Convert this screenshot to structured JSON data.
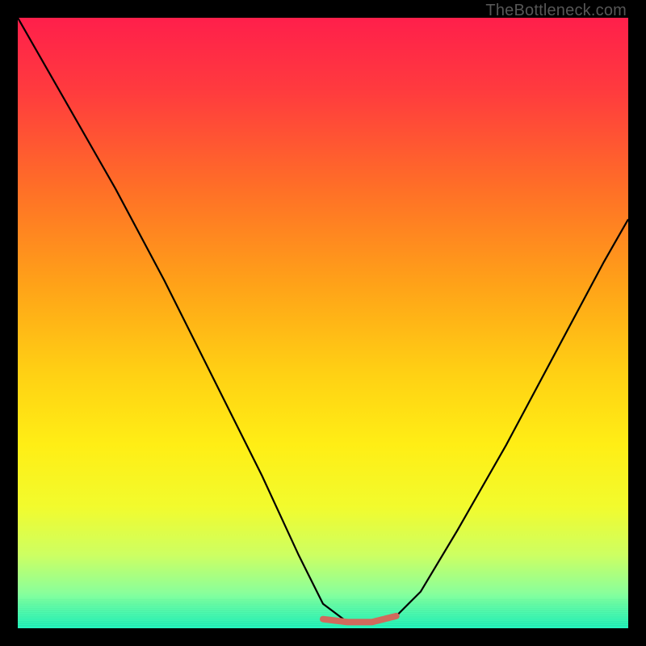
{
  "watermark": "TheBottleneck.com",
  "colors": {
    "black": "#000000",
    "gradient": [
      "#ff1850",
      "#ff4e36",
      "#ff8a1e",
      "#ffc716",
      "#ffe813",
      "#f7fc25",
      "#e0ff55",
      "#9dff8c",
      "#4cffb8",
      "#18ffc8"
    ],
    "curve_main": "#000000",
    "curve_accent": "#d06a5c",
    "green_band_top": "#2dffc0",
    "green_band_bottom": "#18e0b0"
  },
  "chart_data": {
    "type": "line",
    "title": "",
    "xlabel": "",
    "ylabel": "",
    "xlim": [
      0,
      100
    ],
    "ylim": [
      0,
      100
    ],
    "series": [
      {
        "name": "bottleneck-curve",
        "x": [
          0,
          8,
          16,
          24,
          32,
          40,
          46,
          50,
          54,
          58,
          62,
          66,
          72,
          80,
          88,
          96,
          100
        ],
        "values": [
          100,
          86,
          72,
          57,
          41,
          25,
          12,
          4,
          1,
          1,
          2,
          6,
          16,
          30,
          45,
          60,
          67
        ]
      },
      {
        "name": "optimal-zone",
        "x": [
          50,
          54,
          58,
          62
        ],
        "values": [
          1.5,
          1,
          1,
          2
        ]
      }
    ],
    "annotations": []
  }
}
